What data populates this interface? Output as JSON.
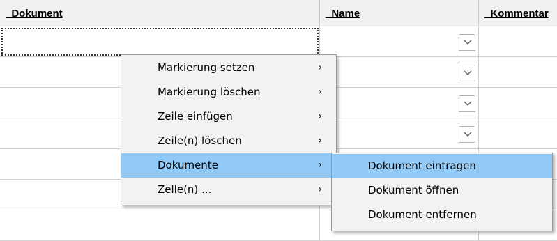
{
  "columns": [
    "_Dokument",
    "_Name",
    "_Kommentar"
  ],
  "row_count": 7,
  "context_menu": {
    "items": [
      {
        "label": "Markierung setzen",
        "arrow": "›"
      },
      {
        "label": "Markierung löschen",
        "arrow": "›"
      },
      {
        "label": "Zeile einfügen",
        "arrow": "›"
      },
      {
        "label": "Zeile(n) löschen",
        "arrow": "›"
      },
      {
        "label": "Dokumente",
        "arrow": "›",
        "highlighted": true
      },
      {
        "label": "Zelle(n) ...",
        "arrow": "›"
      }
    ]
  },
  "submenu": {
    "items": [
      {
        "label": "Dokument eintragen",
        "highlighted": true
      },
      {
        "label": "Dokument öffnen"
      },
      {
        "label": "Dokument entfernen"
      }
    ]
  },
  "colors": {
    "header_bg": "#f0f0f0",
    "menu_bg": "#f2f2f2",
    "highlight": "#91c9f7"
  },
  "icons": {
    "combo": "chevron-down-icon",
    "submenu": "chevron-right-icon"
  }
}
